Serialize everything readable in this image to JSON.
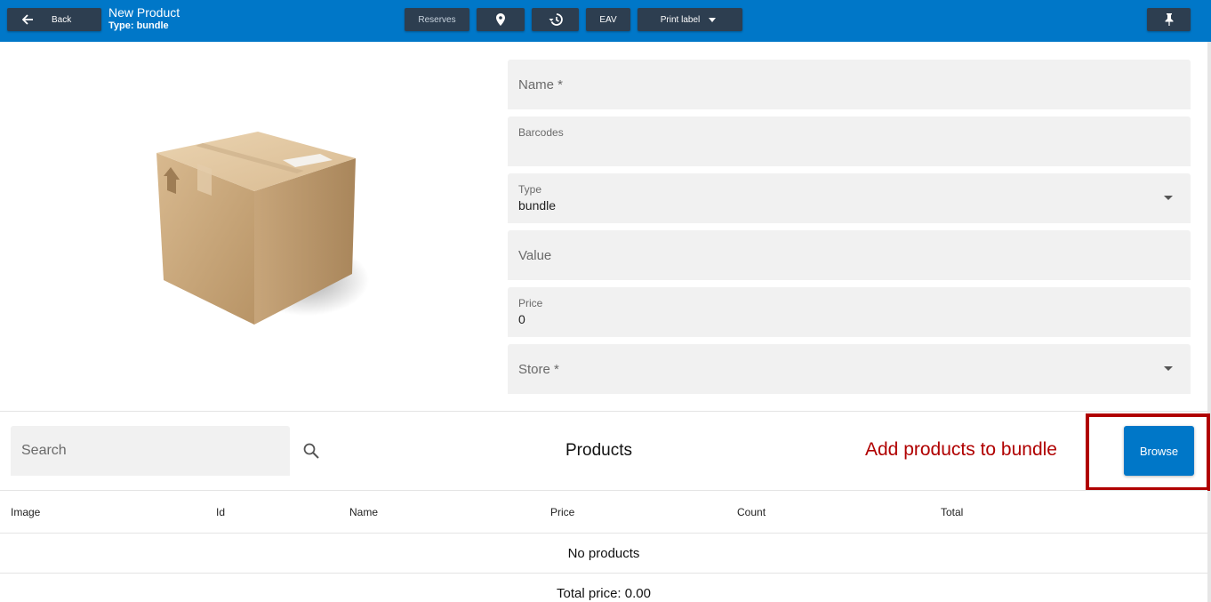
{
  "header": {
    "back_label": "Back",
    "title": "New Product",
    "subtitle": "Type: bundle",
    "reserves_label": "Reserves",
    "eav_label": "EAV",
    "print_label": "Print label",
    "location_icon": "location-pin-icon",
    "history_icon": "history-icon",
    "pin_icon": "pin-icon"
  },
  "form": {
    "name_placeholder": "Name *",
    "barcodes_label": "Barcodes",
    "type_label": "Type",
    "type_value": "bundle",
    "value_placeholder": "Value",
    "price_label": "Price",
    "price_value": "0",
    "store_placeholder": "Store *"
  },
  "products": {
    "search_placeholder": "Search",
    "title": "Products",
    "annotation": "Add products to bundle",
    "browse_label": "Browse",
    "columns": [
      "Image",
      "Id",
      "Name",
      "Price",
      "Count",
      "Total"
    ],
    "empty_text": "No products",
    "total_text": "Total price: 0.00"
  },
  "colors": {
    "topbar": "#0077c8",
    "button_dark": "#2d3e50",
    "annotation": "#b00000",
    "field_bg": "#f1f1f1"
  }
}
